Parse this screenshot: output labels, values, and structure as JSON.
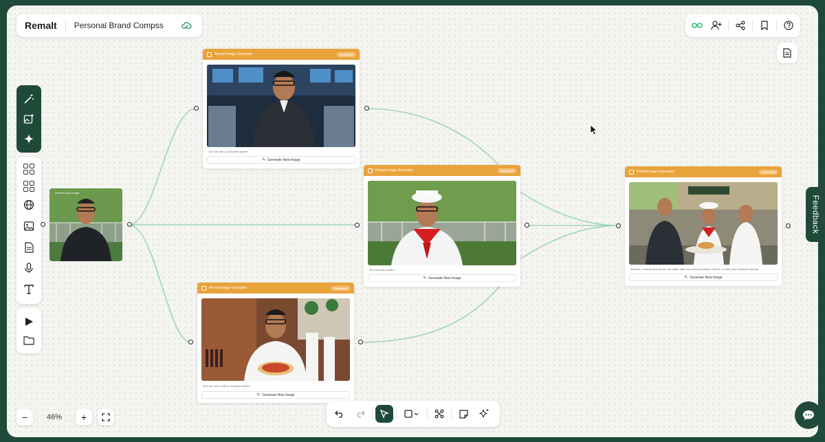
{
  "app": {
    "brand": "Remalt",
    "project": "Personal Brand Compss"
  },
  "colors": {
    "accent": "#1f4a3a",
    "card_header": "#e9a33b",
    "edge": "#9fd4bf"
  },
  "source": {
    "label": "Linkedin post image"
  },
  "cards": [
    {
      "title": "Remalt Image Generator",
      "badge": "Generated",
      "caption": "Turn me into a wall street broker",
      "button": "Generate New Image"
    },
    {
      "title": "Remalt Image Generator",
      "badge": "Generated",
      "caption": "Turn me into a sailor",
      "button": "Generate New Image"
    },
    {
      "title": "Remalt Image Generator",
      "badge": "Generated",
      "caption": "Turn me into a chef in an Itaian kitchen",
      "button": "Generate New Image"
    },
    {
      "title": "Remalt Image Generator",
      "badge": "Generated",
      "caption": "All these 3 friends (the broker, the sailor and chef meet in parisian café for a coffee and croissant catchup",
      "button": "Generate New Image"
    }
  ],
  "zoom": {
    "value": "46%"
  },
  "feedback": {
    "label": "Feedback"
  }
}
